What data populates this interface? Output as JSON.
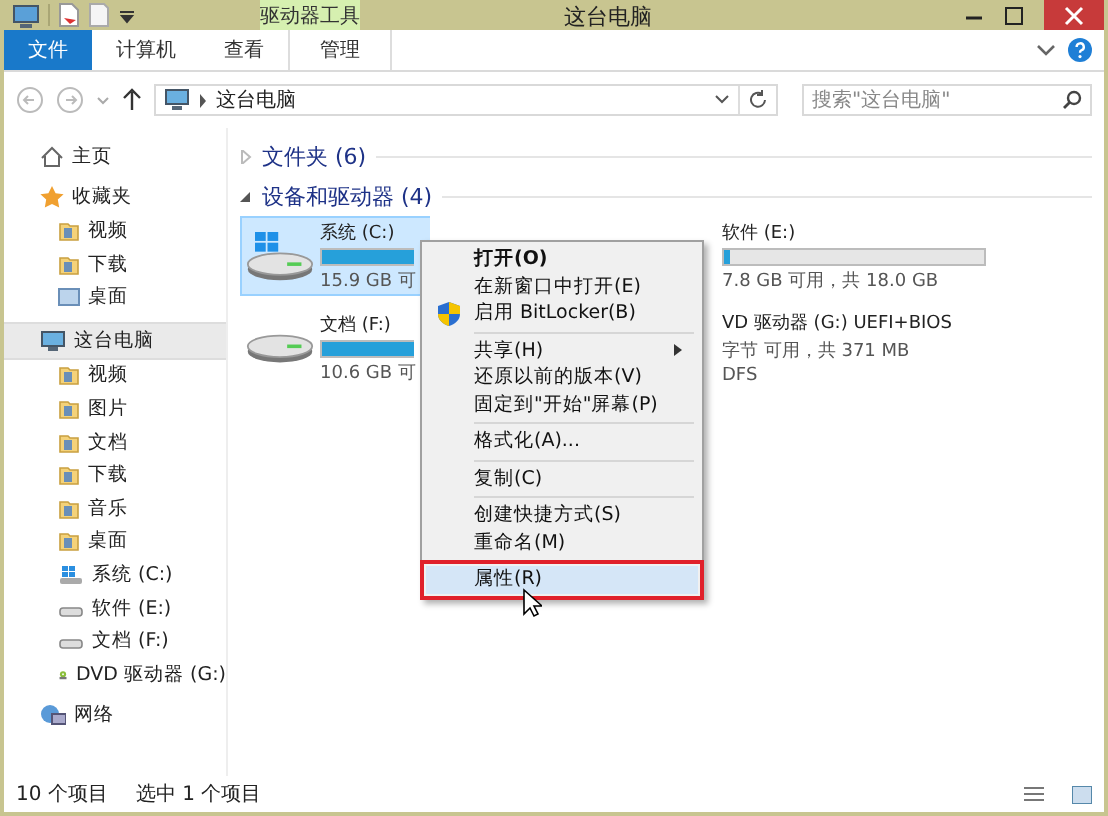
{
  "window": {
    "title": "这台电脑",
    "context_tab": "驱动器工具"
  },
  "ribbon_tabs": [
    {
      "label": "文件",
      "kind": "file",
      "selected": false
    },
    {
      "label": "计算机",
      "kind": "tab",
      "selected": false
    },
    {
      "label": "查看",
      "kind": "tab",
      "selected": false
    },
    {
      "label": "管理",
      "kind": "context",
      "selected": false
    }
  ],
  "address": {
    "path": "这台电脑",
    "search_placeholder": "搜索\"这台电脑\""
  },
  "sidebar": [
    {
      "label": "主页",
      "kind": "home",
      "selected": false
    },
    {
      "label": "收藏夹",
      "kind": "star",
      "selected": false,
      "children": [
        {
          "label": "视频",
          "kind": "folder"
        },
        {
          "label": "下载",
          "kind": "folder"
        },
        {
          "label": "桌面",
          "kind": "desktop"
        }
      ]
    },
    {
      "label": "这台电脑",
      "kind": "pc",
      "selected": true,
      "children": [
        {
          "label": "视频",
          "kind": "folder"
        },
        {
          "label": "图片",
          "kind": "folder"
        },
        {
          "label": "文档",
          "kind": "folder"
        },
        {
          "label": "下载",
          "kind": "folder"
        },
        {
          "label": "音乐",
          "kind": "folder"
        },
        {
          "label": "桌面",
          "kind": "folder"
        },
        {
          "label": "系统 (C:)",
          "kind": "windrive"
        },
        {
          "label": "软件 (E:)",
          "kind": "drive"
        },
        {
          "label": "文档 (F:)",
          "kind": "drive"
        },
        {
          "label": "DVD 驱动器 (G:)",
          "kind": "dvd"
        }
      ]
    },
    {
      "label": "网络",
      "kind": "network",
      "selected": false
    }
  ],
  "groups": [
    {
      "label": "文件夹 (6)",
      "expanded": false
    },
    {
      "label": "设备和驱动器 (4)",
      "expanded": true
    }
  ],
  "drives": [
    {
      "name": "系统 (C:)",
      "kind": "windrive",
      "selected": true,
      "level": 1,
      "free": "15.9 GB 可"
    },
    {
      "name": "软件 (E:)",
      "kind": "hidden",
      "selected": false,
      "level": 0.02,
      "free": "7.8 GB 可用，共 18.0 GB"
    },
    {
      "name": "文档 (F:)",
      "kind": "drive",
      "selected": false,
      "level": 1,
      "free": "10.6 GB 可"
    },
    {
      "name": "VD 驱动器 (G:) UEFI+BIOS",
      "kind": "hidden",
      "selected": false,
      "free": "字节 可用，共 371 MB",
      "extra": "DFS"
    }
  ],
  "context_menu": [
    {
      "label": "打开(O)",
      "kind": "bold",
      "selected": false
    },
    {
      "label": "在新窗口中打开(E)",
      "kind": "item",
      "selected": false
    },
    {
      "label": "启用 BitLocker(B)",
      "kind": "shield",
      "selected": false
    },
    {
      "kind": "separator"
    },
    {
      "label": "共享(H)",
      "kind": "submenu",
      "selected": false
    },
    {
      "label": "还原以前的版本(V)",
      "kind": "item",
      "selected": false
    },
    {
      "label": "固定到\"开始\"屏幕(P)",
      "kind": "item",
      "selected": false
    },
    {
      "kind": "separator"
    },
    {
      "label": "格式化(A)...",
      "kind": "item",
      "selected": false
    },
    {
      "kind": "separator"
    },
    {
      "label": "复制(C)",
      "kind": "item",
      "selected": false
    },
    {
      "kind": "separator"
    },
    {
      "label": "创建快捷方式(S)",
      "kind": "item",
      "selected": false
    },
    {
      "label": "重命名(M)",
      "kind": "item",
      "selected": false
    },
    {
      "kind": "separator"
    },
    {
      "label": "属性(R)",
      "kind": "item",
      "selected": true
    }
  ],
  "status_bar": {
    "count": "10 个项目",
    "selection": "选中 1 个项目"
  }
}
